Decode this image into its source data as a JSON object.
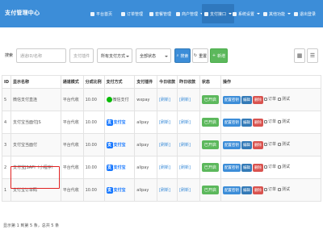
{
  "navbar": {
    "brand": "支付管理中心",
    "items": [
      {
        "label": "平台首页",
        "icon": "home-icon"
      },
      {
        "label": "订单管理",
        "icon": "order-icon"
      },
      {
        "label": "套餐管理",
        "icon": "package-icon"
      },
      {
        "label": "商户管理",
        "icon": "user-icon"
      },
      {
        "label": "支付接口",
        "icon": "plug-icon"
      },
      {
        "label": "系统设置",
        "icon": "gear-icon"
      },
      {
        "label": "其他功能",
        "icon": "apps-icon"
      },
      {
        "label": "退出登录",
        "icon": "logout-icon"
      }
    ],
    "active_index": 4
  },
  "toolbar": {
    "search_label": "搜索",
    "name_placeholder": "通道ID/名称",
    "plugin_placeholder": "支付插件",
    "type_select": "所有支付方式",
    "status_select": "全部状态",
    "search_button": "搜索",
    "reset_button": "重置",
    "add_button": "新增"
  },
  "table": {
    "columns": [
      "ID",
      "显示名称",
      "通道模式",
      "分成比例",
      "支付方式",
      "支付插件",
      "今日收款",
      "昨日收款",
      "状态",
      "操作"
    ],
    "rows": [
      {
        "id": "5",
        "name": "微信支付直连",
        "mode": "平台代收",
        "rate": "10.00",
        "pay": "微信支付",
        "pay_kind": "wechat",
        "plugin": "wxpay",
        "today": "[刷新]",
        "yesterday": "[刷新]",
        "status": "已开启"
      },
      {
        "id": "4",
        "name": "支付宝当面付JS",
        "mode": "平台代收",
        "rate": "10.00",
        "pay": "支付宝",
        "pay_kind": "alipay",
        "plugin": "alipay",
        "today": "[刷新]",
        "yesterday": "[刷新]",
        "status": "已开启"
      },
      {
        "id": "3",
        "name": "支付宝当面付",
        "mode": "平台代收",
        "rate": "10.00",
        "pay": "支付宝",
        "pay_kind": "alipay",
        "plugin": "alipay",
        "today": "[刷新]",
        "yesterday": "[刷新]",
        "status": "已开启"
      },
      {
        "id": "2",
        "name": "支付宝JSAPI（小程序）",
        "mode": "平台代收",
        "rate": "10.00",
        "pay": "支付宝",
        "pay_kind": "alipay",
        "plugin": "alipay",
        "today": "[刷新]",
        "yesterday": "[刷新]",
        "status": "已开启"
      },
      {
        "id": "1",
        "name": "支付宝订单码",
        "mode": "平台代收",
        "rate": "10.00",
        "pay": "支付宝",
        "pay_kind": "alipay",
        "plugin": "alipay",
        "today": "[刷新]",
        "yesterday": "[刷新]",
        "status": "已开启"
      }
    ],
    "actions": {
      "config": "配置密钥",
      "edit": "编辑",
      "delete": "删除",
      "order": "订单",
      "test": "测试"
    }
  },
  "footer": "显示第 1 到第 5 条，总共 5 条",
  "colors": {
    "nav": "#3c8dd8",
    "wechat": "#09bb07",
    "alipay": "#1677ff",
    "status_on": "#5cb85c",
    "highlight": "#e02020"
  }
}
